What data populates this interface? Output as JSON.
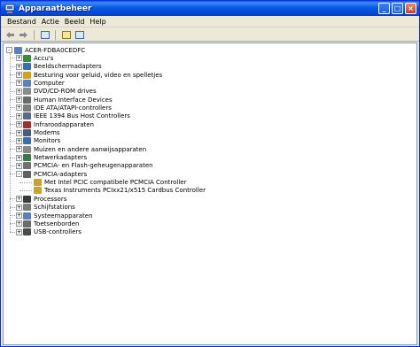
{
  "window": {
    "title": "Apparaatbeheer",
    "controls": [
      "_",
      "□",
      "×"
    ]
  },
  "menu": [
    "Bestand",
    "Actie",
    "Beeld",
    "Help"
  ],
  "toolbar": {
    "items": [
      "back-icon",
      "forward-icon",
      "properties-icon",
      "help-icon",
      "scan-icon"
    ]
  },
  "tree": {
    "root": "ACER-FDBA0CEDFC",
    "categories": [
      {
        "label": "Accu's",
        "icon": "battery-icon",
        "color": "#3a8a3a"
      },
      {
        "label": "Beeldschermadapters",
        "icon": "display-adapter-icon",
        "color": "#3b6db3"
      },
      {
        "label": "Besturing voor geluid, video en spelletjes",
        "icon": "sound-icon",
        "color": "#d4a018"
      },
      {
        "label": "Computer",
        "icon": "computer-icon",
        "color": "#5a7fbf"
      },
      {
        "label": "DVD/CD-ROM drives",
        "icon": "cdrom-icon",
        "color": "#8a8a8a"
      },
      {
        "label": "Human Interface Devices",
        "icon": "hid-icon",
        "color": "#6a6a6a"
      },
      {
        "label": "IDE ATA/ATAPI-controllers",
        "icon": "ide-icon",
        "color": "#7a7a7a"
      },
      {
        "label": "IEEE 1394 Bus Host Controllers",
        "icon": "firewire-icon",
        "color": "#5a6a8a"
      },
      {
        "label": "Infraroodapparaten",
        "icon": "infrared-icon",
        "color": "#a03030"
      },
      {
        "label": "Modems",
        "icon": "modem-icon",
        "color": "#4a5a7a"
      },
      {
        "label": "Monitors",
        "icon": "monitor-icon",
        "color": "#3b6db3"
      },
      {
        "label": "Muizen en andere aanwijsapparaten",
        "icon": "mouse-icon",
        "color": "#8a8a8a"
      },
      {
        "label": "Netwerkadapters",
        "icon": "network-icon",
        "color": "#3a7a4a"
      },
      {
        "label": "PCMCIA- en Flash-geheugenapparaten",
        "icon": "pcmcia-icon",
        "color": "#707070"
      },
      {
        "label": "PCMCIA-adapters",
        "icon": "pcmcia-adapter-icon",
        "color": "#606060",
        "expanded": true,
        "children": [
          "Met Intel PCIC compatibele PCMCIA Controller",
          "Texas Instruments PCIxx21/x515 Cardbus Controller"
        ]
      },
      {
        "label": "Processors",
        "icon": "processor-icon",
        "color": "#3a3a3a"
      },
      {
        "label": "Schijfstations",
        "icon": "disk-icon",
        "color": "#7a7a7a"
      },
      {
        "label": "Systeemapparaten",
        "icon": "system-icon",
        "color": "#5a7fbf"
      },
      {
        "label": "Toetsenborden",
        "icon": "keyboard-icon",
        "color": "#6a6a6a"
      },
      {
        "label": "USB-controllers",
        "icon": "usb-icon",
        "color": "#4a4a4a"
      }
    ]
  }
}
